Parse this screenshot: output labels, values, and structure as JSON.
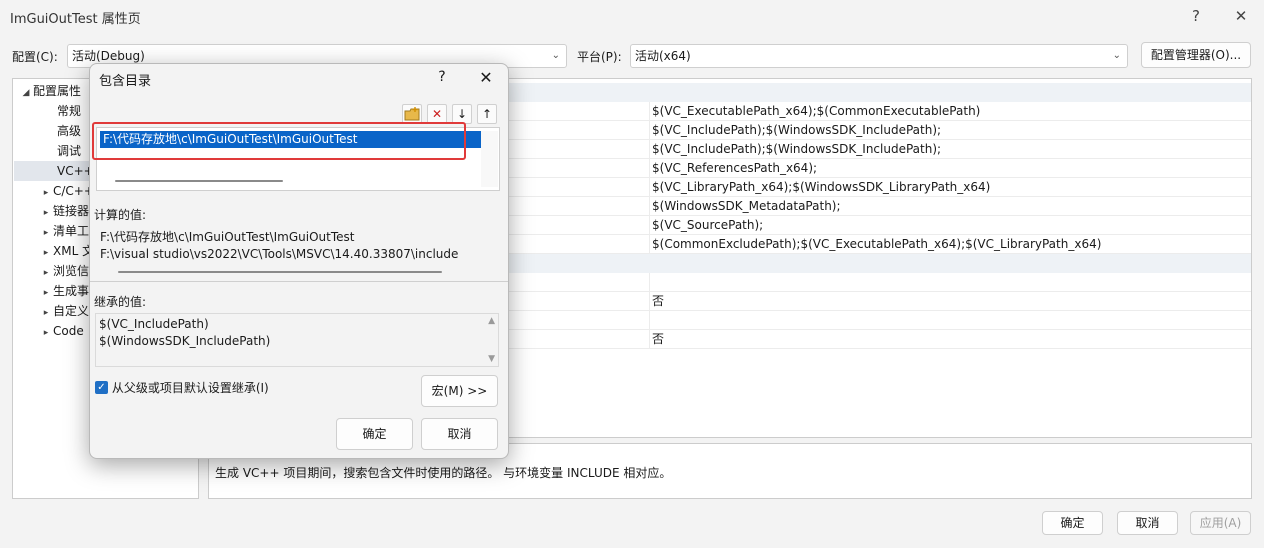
{
  "window": {
    "title": "ImGuiOutTest 属性页",
    "help_glyph": "?",
    "close_glyph": "✕"
  },
  "toolbar": {
    "config_label": "配置(C):",
    "config_value": "活动(Debug)",
    "platform_label": "平台(P):",
    "platform_value": "活动(x64)",
    "config_manager": "配置管理器(O)..."
  },
  "tree": {
    "root": "配置属性",
    "items": [
      "常规",
      "高级",
      "调试",
      "VC++",
      "C/C++",
      "链接器",
      "清单工",
      "XML 文",
      "浏览信",
      "生成事",
      "自定义",
      "Code"
    ]
  },
  "props": {
    "values": [
      "$(VC_ExecutablePath_x64);$(CommonExecutablePath)",
      "$(VC_IncludePath);$(WindowsSDK_IncludePath);",
      "$(VC_IncludePath);$(WindowsSDK_IncludePath);",
      "$(VC_ReferencesPath_x64);",
      "$(VC_LibraryPath_x64);$(WindowsSDK_LibraryPath_x64)",
      "$(WindowsSDK_MetadataPath);",
      "$(VC_SourcePath);",
      "$(CommonExcludePath);$(VC_ExecutablePath_x64);$(VC_LibraryPath_x64)"
    ],
    "no_1": "否",
    "no_2": "否"
  },
  "description": "生成 VC++ 项目期间，搜索包含文件时使用的路径。 与环境变量 INCLUDE 相对应。",
  "footer": {
    "ok": "确定",
    "cancel": "取消",
    "apply": "应用(A)"
  },
  "dialog": {
    "title": "包含目录",
    "help_glyph": "?",
    "close_glyph": "✕",
    "entries": [
      "F:\\代码存放地\\c\\ImGuiOutTest\\ImGuiOutTest"
    ],
    "computed_label": "计算的值:",
    "computed_values": [
      "F:\\代码存放地\\c\\ImGuiOutTest\\ImGuiOutTest",
      "F:\\visual studio\\vs2022\\VC\\Tools\\MSVC\\14.40.33807\\include"
    ],
    "inherited_label": "继承的值:",
    "inherited_values": [
      "$(VC_IncludePath)",
      "$(WindowsSDK_IncludePath)"
    ],
    "inherit_checkbox": "从父级或项目默认设置继承(I)",
    "macro_button": "宏(M) >>",
    "ok": "确定",
    "cancel": "取消"
  },
  "colors": {
    "accent": "#0a64c8",
    "highlight_box": "#e03a3a",
    "delete_icon": "#cc1f1f"
  }
}
